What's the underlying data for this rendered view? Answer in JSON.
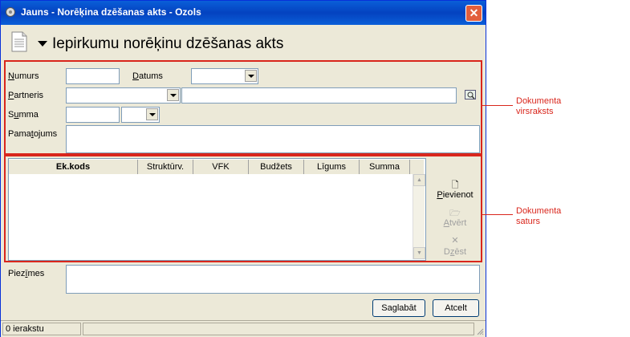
{
  "window": {
    "title": "Jauns - Norēķina dzēšanas akts - Ozols",
    "close_glyph": "✕"
  },
  "page": {
    "heading": "Iepirkumu norēķinu dzēšanas akts"
  },
  "header_form": {
    "numurs": {
      "label_u": "N",
      "label_rest": "umurs",
      "value": ""
    },
    "datums": {
      "label_u": "D",
      "label_rest": "atums",
      "value": ""
    },
    "partneris": {
      "label_u": "P",
      "label_rest": "artneris",
      "value": "",
      "name_value": ""
    },
    "summa": {
      "label_pre": "S",
      "label_u": "u",
      "label_rest": "mma",
      "value": "",
      "currency": ""
    },
    "pamatojums": {
      "label_pre": "Pama",
      "label_u": "t",
      "label_rest": "ojums",
      "value": ""
    }
  },
  "grid": {
    "columns": [
      "Ek.kods",
      "Struktūrv.",
      "VFK",
      "Budžets",
      "Līgums",
      "Summa"
    ],
    "rows": []
  },
  "side_actions": {
    "add": {
      "label_u": "P",
      "label_rest": "ievienot",
      "icon": "new-document-icon"
    },
    "open": {
      "label_u": "A",
      "label_rest": "tvērt",
      "icon": "open-folder-icon"
    },
    "delete": {
      "label_pre": "D",
      "label_u": "z",
      "label_rest": "ēst",
      "icon": "delete-x-icon"
    }
  },
  "notes": {
    "label_pre": "Piez",
    "label_u": "ī",
    "label_rest": "mes",
    "value": ""
  },
  "buttons": {
    "save": "Saglabāt",
    "cancel": "Atcelt"
  },
  "status": {
    "count": "0 ierakstu"
  },
  "callouts": {
    "header": [
      "Dokumenta",
      "virsraksts"
    ],
    "content": [
      "Dokumenta",
      "saturs"
    ]
  },
  "colors": {
    "accent_red": "#d9261c",
    "titlebar": "#0a5fd8",
    "window_bg": "#ece9d8"
  }
}
